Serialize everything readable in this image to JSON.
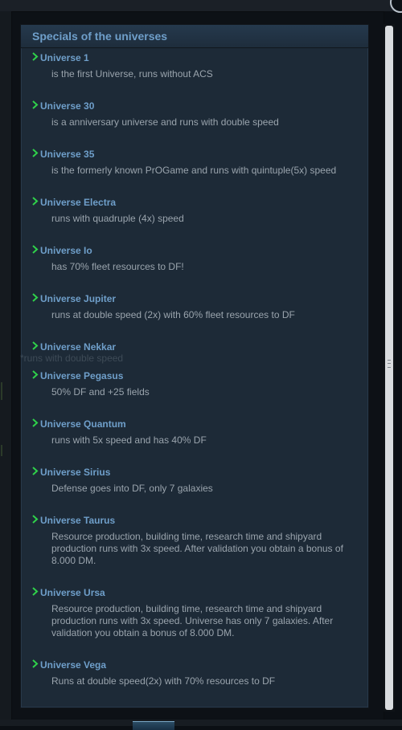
{
  "panel": {
    "title": "Specials of the universes"
  },
  "colors": {
    "background": "#0b0f14",
    "panel": "#1d2a37",
    "title_blue": "#6f9fca",
    "text_gray": "#9aa4ad",
    "chevron_green": "#2fd14a"
  },
  "universes": [
    {
      "name": "Universe 1",
      "desc": "is the first Universe, runs without ACS"
    },
    {
      "name": "Universe 30",
      "desc": "is a anniversary universe and runs with double speed"
    },
    {
      "name": "Universe 35",
      "desc": "is the formerly known PrOGame and runs with quintuple(5x) speed"
    },
    {
      "name": "Universe Electra",
      "desc": "runs with quadruple (4x) speed"
    },
    {
      "name": "Universe Io",
      "desc": "has 70% fleet resources to DF!"
    },
    {
      "name": "Universe Jupiter",
      "desc": "runs at double speed (2x) with 60% fleet resources to DF"
    },
    {
      "name": "Universe Nekkar",
      "note": "*runs with double speed"
    },
    {
      "name": "Universe Pegasus",
      "desc": "50% DF and +25 fields"
    },
    {
      "name": "Universe Quantum",
      "desc": "runs with 5x speed and has 40% DF"
    },
    {
      "name": "Universe Sirius",
      "desc": "Defense goes into DF, only 7 galaxies"
    },
    {
      "name": "Universe Taurus",
      "desc": "Resource production, building time, research time and shipyard production runs with 3x speed. After validation you obtain a bonus of 8.000 DM."
    },
    {
      "name": "Universe Ursa",
      "desc": "Resource production, building time, research time and shipyard production runs with 3x speed. Universe has only 7 galaxies. After validation you obtain a bonus of 8.000 DM."
    },
    {
      "name": "Universe Vega",
      "desc": "Runs at double speed(2x) with 70% resources to DF"
    }
  ]
}
